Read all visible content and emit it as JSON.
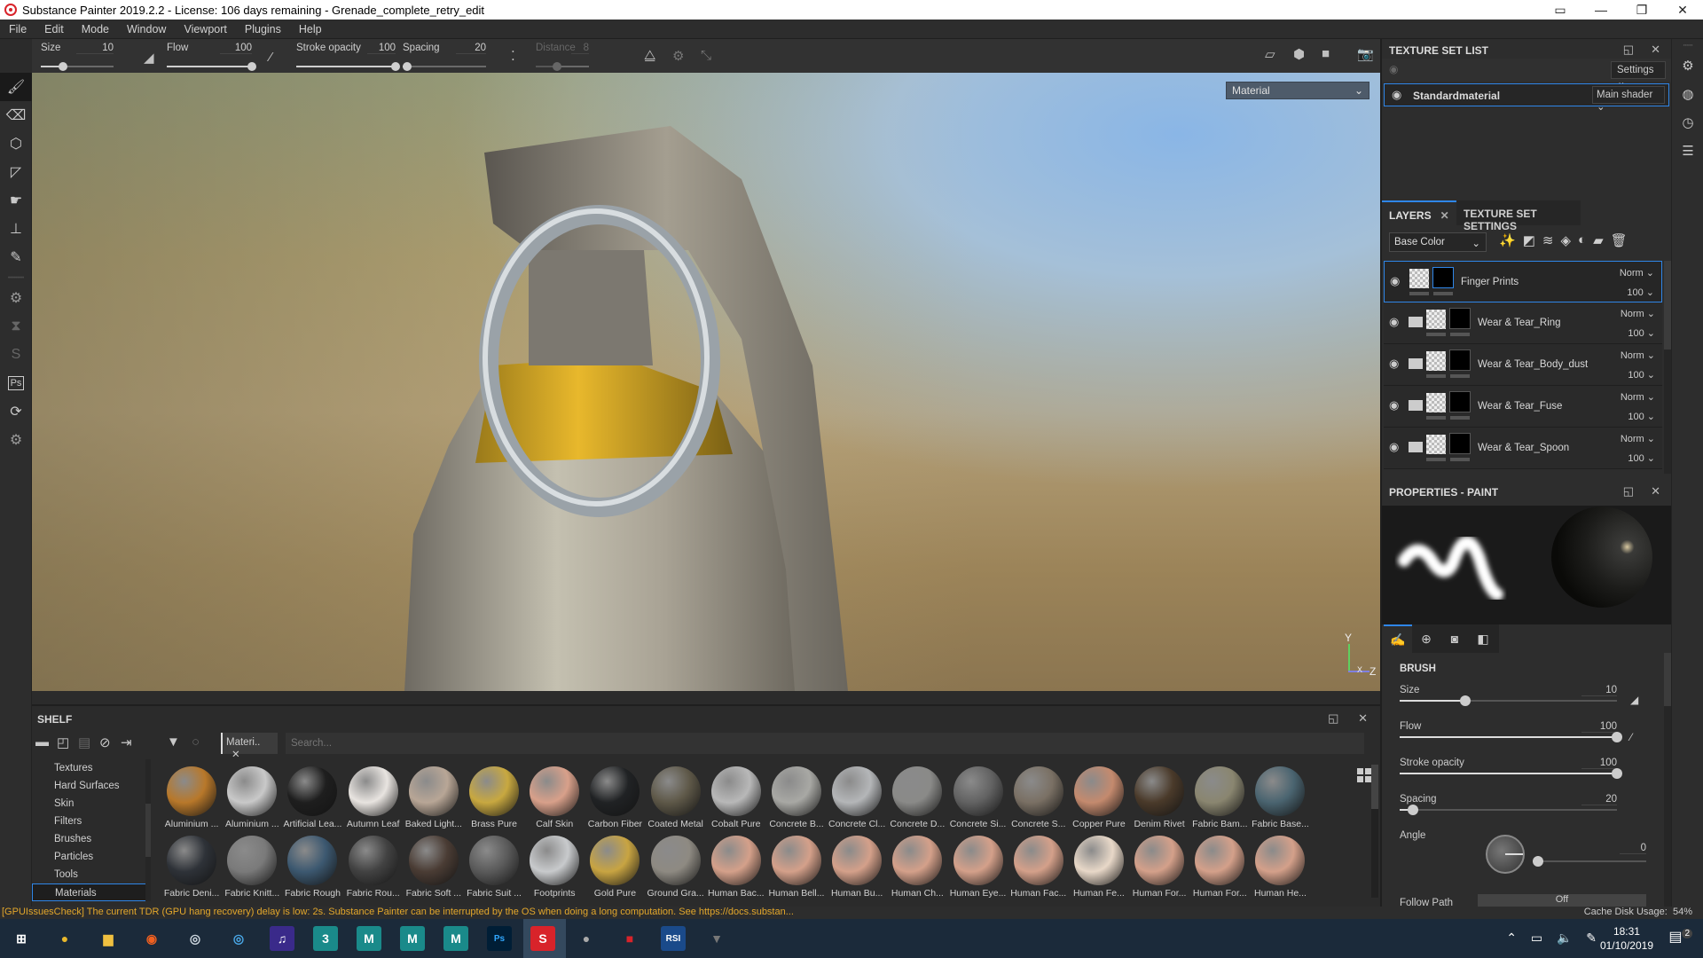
{
  "window": {
    "title": "Substance Painter 2019.2.2 - License: 106 days remaining - Grenade_complete_retry_edit",
    "controls": [
      "tablet-mode",
      "minimize",
      "restore",
      "close"
    ]
  },
  "menu": [
    "File",
    "Edit",
    "Mode",
    "Window",
    "Viewport",
    "Plugins",
    "Help"
  ],
  "toolbar": {
    "size": {
      "label": "Size",
      "value": "10",
      "fraction": 0.3
    },
    "flow": {
      "label": "Flow",
      "value": "100",
      "fraction": 1.0
    },
    "stroke_opacity": {
      "label": "Stroke opacity",
      "value": "100",
      "fraction": 1.0
    },
    "spacing": {
      "label": "Spacing",
      "value": "20",
      "fraction": 0.05
    },
    "distance": {
      "label": "Distance",
      "value": "8",
      "fraction": 0.4,
      "disabled": true
    }
  },
  "left_tools": [
    "paint-brush",
    "eraser",
    "projection",
    "polygon-fill",
    "smudge",
    "clone-stamp",
    "color-picker",
    "separator",
    "substance-plugin",
    "hourglass",
    "substance-share",
    "photoshop-export",
    "resource-updater",
    "substance-source"
  ],
  "viewport": {
    "mode_select": "Material",
    "axis": {
      "y": "Y",
      "x": "X",
      "z": "Z"
    }
  },
  "shelf": {
    "title": "SHELF",
    "filter_chip": "Materi..",
    "search_placeholder": "Search...",
    "categories": [
      "Textures",
      "Hard Surfaces",
      "Skin",
      "Filters",
      "Brushes",
      "Particles",
      "Tools",
      "Materials"
    ],
    "selected_category": "Materials",
    "materials": [
      {
        "name": "Aluminium ...",
        "color": "#b8782a"
      },
      {
        "name": "Aluminium ...",
        "color": "#c9c9c9"
      },
      {
        "name": "Artificial Lea...",
        "color": "#1e1e1e"
      },
      {
        "name": "Autumn Leaf",
        "color": "#e8e4e0"
      },
      {
        "name": "Baked Light...",
        "color": "#b8a696"
      },
      {
        "name": "Brass Pure",
        "color": "#c8a840"
      },
      {
        "name": "Calf Skin",
        "color": "#d8a08a"
      },
      {
        "name": "Carbon Fiber",
        "color": "#202224"
      },
      {
        "name": "Coated Metal",
        "color": "#5e5848"
      },
      {
        "name": "Cobalt Pure",
        "color": "#b8b8b8"
      },
      {
        "name": "Concrete B...",
        "color": "#a8a8a4"
      },
      {
        "name": "Concrete Cl...",
        "color": "#b4b6b8"
      },
      {
        "name": "Concrete D...",
        "color": "#8a8a88"
      },
      {
        "name": "Concrete Si...",
        "color": "#626262"
      },
      {
        "name": "Concrete S...",
        "color": "#7a7064"
      },
      {
        "name": "Copper Pure",
        "color": "#c48a6e"
      },
      {
        "name": "Denim Rivet",
        "color": "#4a3a2a"
      },
      {
        "name": "Fabric Bam...",
        "color": "#8a8670"
      },
      {
        "name": "Fabric Base...",
        "color": "#4a6470"
      },
      {
        "name": "Fabric Deni...",
        "color": "#2e3238"
      },
      {
        "name": "Fabric Knitt...",
        "color": "#7a7a7a"
      },
      {
        "name": "Fabric Rough",
        "color": "#3c5870"
      },
      {
        "name": "Fabric Rou...",
        "color": "#424242"
      },
      {
        "name": "Fabric Soft ...",
        "color": "#4a3c34"
      },
      {
        "name": "Fabric Suit ...",
        "color": "#5a5a5a"
      },
      {
        "name": "Footprints",
        "color": "#c8cacc"
      },
      {
        "name": "Gold Pure",
        "color": "#c8a442"
      },
      {
        "name": "Ground Gra...",
        "color": "#8e8a82"
      },
      {
        "name": "Human Bac...",
        "color": "#d4a08a"
      },
      {
        "name": "Human Bell...",
        "color": "#d4a08a"
      },
      {
        "name": "Human Bu...",
        "color": "#d4a08a"
      },
      {
        "name": "Human Ch...",
        "color": "#d4a08a"
      },
      {
        "name": "Human Eye...",
        "color": "#d4a08a"
      },
      {
        "name": "Human Fac...",
        "color": "#d4a08a"
      },
      {
        "name": "Human Fe...",
        "color": "#e8d8c8"
      },
      {
        "name": "Human For...",
        "color": "#d4a08a"
      },
      {
        "name": "Human For...",
        "color": "#d4a08a"
      },
      {
        "name": "Human He...",
        "color": "#d4a08a"
      }
    ]
  },
  "texture_set_list": {
    "title": "TEXTURE SET LIST",
    "settings_label": "Settings",
    "material_name": "Standardmaterial",
    "shader": "Main shader"
  },
  "layers": {
    "tab_label": "LAYERS",
    "tab2_label": "TEXTURE SET SETTINGS",
    "channel": "Base Color",
    "tool_icons": [
      "add-effect",
      "add-mask",
      "add-layer",
      "add-fill-layer",
      "add-smart-mask",
      "add-folder",
      "delete"
    ],
    "items": [
      {
        "name": "Finger Prints",
        "blend": "Norm",
        "opacity": "100",
        "folder": false,
        "selected": true
      },
      {
        "name": "Wear & Tear_Ring",
        "blend": "Norm",
        "opacity": "100",
        "folder": true,
        "selected": false
      },
      {
        "name": "Wear & Tear_Body_dust",
        "blend": "Norm",
        "opacity": "100",
        "folder": true,
        "selected": false
      },
      {
        "name": "Wear & Tear_Fuse",
        "blend": "Norm",
        "opacity": "100",
        "folder": true,
        "selected": false
      },
      {
        "name": "Wear & Tear_Spoon",
        "blend": "Norm",
        "opacity": "100",
        "folder": true,
        "selected": false
      }
    ]
  },
  "properties": {
    "title": "PROPERTIES - PAINT",
    "section": "BRUSH",
    "size": {
      "label": "Size",
      "value": "10",
      "fraction": 0.3
    },
    "flow": {
      "label": "Flow",
      "value": "100",
      "fraction": 1.0
    },
    "stroke_opacity": {
      "label": "Stroke opacity",
      "value": "100",
      "fraction": 1.0
    },
    "spacing": {
      "label": "Spacing",
      "value": "20",
      "fraction": 0.06
    },
    "angle": {
      "label": "Angle",
      "value": "0"
    },
    "follow_path": {
      "label": "Follow Path",
      "value": "Off"
    }
  },
  "status": {
    "message": "[GPUIssuesCheck] The current TDR (GPU hang recovery) delay is low: 2s. Substance Painter can be interrupted by the OS when doing a long computation. See https://docs.substan...",
    "cache_label": "Cache Disk Usage:",
    "cache_value": "54%"
  },
  "taskbar": {
    "apps": [
      "windows-start",
      "chrome",
      "file-explorer",
      "origin",
      "steam",
      "uplay",
      "amazon-music",
      "3ds-max",
      "maya",
      "maya",
      "maya",
      "photoshop",
      "substance-painter",
      "app-red-skull",
      "app-red",
      "rsi-launcher",
      "app-bird"
    ],
    "time": "18:31",
    "date": "01/10/2019",
    "notifications": "2"
  }
}
